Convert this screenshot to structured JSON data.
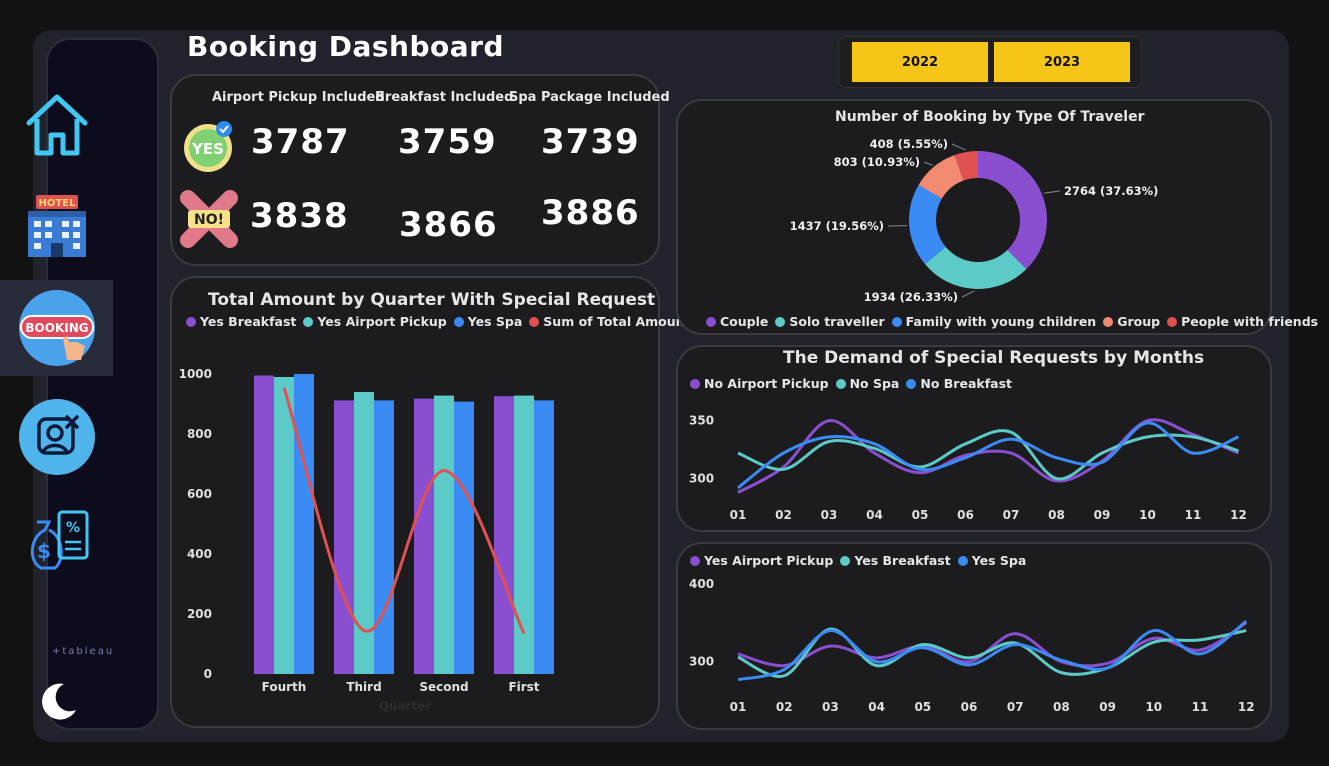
{
  "dashboard": {
    "title": "Booking Dashboard",
    "years": [
      "2022",
      "2023"
    ],
    "sidebar": {
      "hotel_sign": "HOTEL",
      "booking_badge": "BOOKING",
      "tableau_logo": "+tableau"
    },
    "kpis": {
      "headers": [
        "Airport Pickup Included",
        "Breakfast Included",
        "Spa Package Included"
      ],
      "yes_label": "YES",
      "no_label": "NO!",
      "yes_values": [
        "3787",
        "3759",
        "3739"
      ],
      "no_values": [
        "3838",
        "3866",
        "3886"
      ]
    },
    "colors": {
      "purple": "#8a4fd1",
      "teal": "#5ccac6",
      "blue": "#3b8bf5",
      "red": "#e05151",
      "salmon": "#f28b72",
      "accent_yellow": "#f5c518"
    }
  },
  "chart_data": [
    {
      "type": "bar",
      "title": "Total Amount by Quarter With Special Request",
      "xlabel": "Quarter",
      "ylabel": "",
      "categories": [
        "Fourth",
        "Third",
        "Second",
        "First"
      ],
      "ylim": [
        0,
        1000
      ],
      "yticks": [
        "0",
        "200",
        "400",
        "600",
        "800",
        "1000"
      ],
      "series": [
        {
          "name": "Yes Breakfast",
          "color": "#8a4fd1",
          "values": [
            995,
            912,
            918,
            926
          ]
        },
        {
          "name": "Yes Airport Pickup",
          "color": "#5ccac6",
          "values": [
            990,
            940,
            928,
            928
          ]
        },
        {
          "name": "Yes Spa",
          "color": "#3b8bf5",
          "values": [
            1000,
            912,
            908,
            912
          ]
        },
        {
          "name": "Sum of Total Amount",
          "color": "#e05151",
          "kind": "line",
          "values": [
            955,
            145,
            678,
            135
          ]
        }
      ]
    },
    {
      "type": "pie",
      "title": "Number of Booking by Type Of Traveler",
      "slices": [
        {
          "name": "Couple",
          "value": 2764,
          "label": "2764 (37.63%)",
          "color": "#8a4fd1"
        },
        {
          "name": "Solo traveller",
          "value": 1934,
          "label": "1934 (26.33%)",
          "color": "#5ccac6"
        },
        {
          "name": "Family with young children",
          "value": 1437,
          "label": "1437 (19.56%)",
          "color": "#3b8bf5"
        },
        {
          "name": "Group",
          "value": 803,
          "label": "803 (10.93%)",
          "color": "#f28b72"
        },
        {
          "name": "People with friends",
          "value": 408,
          "label": "408 (5.55%)",
          "color": "#e05151"
        }
      ]
    },
    {
      "type": "line",
      "title": "The Demand of Special Requests by Months",
      "x": [
        "01",
        "02",
        "03",
        "04",
        "05",
        "06",
        "07",
        "08",
        "09",
        "10",
        "11",
        "12"
      ],
      "ylim": [
        285,
        360
      ],
      "yticks": [
        "300",
        "350"
      ],
      "series": [
        {
          "name": "No Airport Pickup",
          "color": "#8a4fd1",
          "values": [
            288,
            310,
            350,
            322,
            305,
            320,
            322,
            298,
            315,
            350,
            338,
            322
          ]
        },
        {
          "name": "No Spa",
          "color": "#5ccac6",
          "values": [
            322,
            308,
            332,
            326,
            310,
            330,
            340,
            300,
            322,
            336,
            336,
            324
          ]
        },
        {
          "name": "No Breakfast",
          "color": "#3b8bf5",
          "values": [
            292,
            322,
            336,
            330,
            308,
            318,
            334,
            318,
            314,
            348,
            322,
            336
          ]
        }
      ]
    },
    {
      "type": "line",
      "title": "",
      "x": [
        "01",
        "02",
        "03",
        "04",
        "05",
        "06",
        "07",
        "08",
        "09",
        "10",
        "11",
        "12"
      ],
      "ylim": [
        265,
        410
      ],
      "yticks": [
        "300",
        "400"
      ],
      "series": [
        {
          "name": "Yes Airport Pickup",
          "color": "#8a4fd1",
          "values": [
            310,
            295,
            320,
            305,
            320,
            300,
            336,
            300,
            298,
            330,
            315,
            350
          ]
        },
        {
          "name": "Yes Breakfast",
          "color": "#5ccac6",
          "values": [
            306,
            282,
            342,
            295,
            322,
            305,
            324,
            286,
            292,
            325,
            328,
            340
          ]
        },
        {
          "name": "Yes Spa",
          "color": "#3b8bf5",
          "values": [
            277,
            290,
            340,
            300,
            318,
            296,
            322,
            302,
            292,
            340,
            310,
            352
          ]
        }
      ]
    }
  ]
}
